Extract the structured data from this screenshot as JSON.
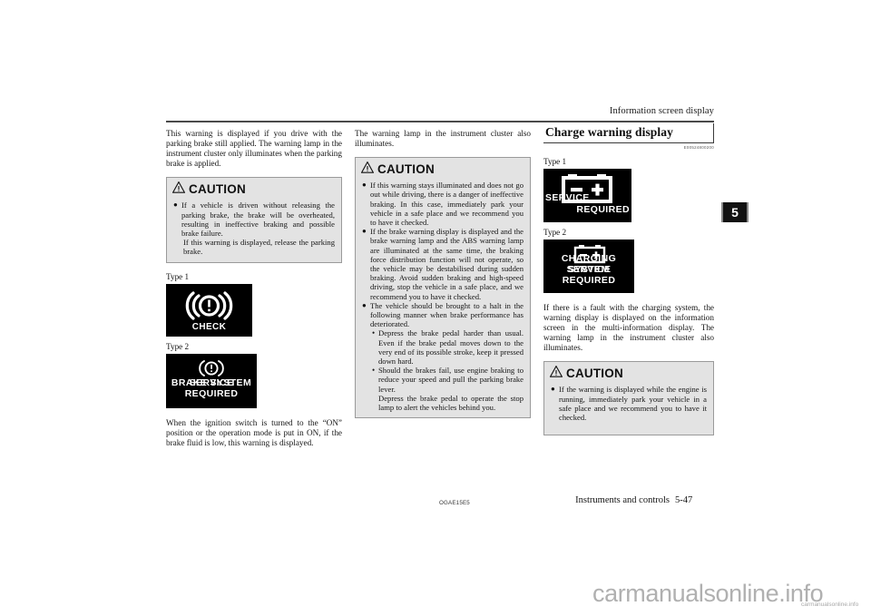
{
  "header": {
    "running_head": "Information screen display",
    "chapter_tab": "5"
  },
  "col1": {
    "intro": "This warning is displayed if you drive with the parking brake still applied. The warning lamp in the instrument cluster only illuminates when the parking brake is applied.",
    "caution": {
      "title": "CAUTION",
      "items": [
        "If a vehicle is driven without releasing the parking brake, the brake will be overheated, resulting in ineffective braking and possible brake failure.",
        "If this warning is displayed, release the parking brake."
      ]
    },
    "fig1_label": "Type 1",
    "fig1_text": "CHECK",
    "fig2_label": "Type 2",
    "fig2_line1": "BRAKE SYSTEM",
    "fig2_line2": "SERVICE REQUIRED",
    "outro": "When the ignition switch is turned to the “ON” position or the operation mode is put in ON, if the brake fluid is low, this warning is displayed."
  },
  "col2": {
    "intro": "The warning lamp in the instrument cluster also illuminates.",
    "caution": {
      "title": "CAUTION",
      "items": [
        "If this warning stays illuminated and does not go out while driving, there is a danger of ineffective braking. In this case, immediately park your vehicle in a safe place and we recommend you to have it checked.",
        "If the brake warning display is displayed and the brake warning lamp and the ABS warning lamp are illuminated at the same time, the braking force distribution function will not operate, so the vehicle may be destabilised during sudden braking. Avoid sudden braking and high-speed driving, stop the vehicle in a safe place, and we recommend you to have it checked.",
        "The vehicle should be brought to a halt in the following manner when brake performance has deteriorated."
      ],
      "subitems": [
        "Depress the brake pedal harder than usual. Even if the brake pedal moves down to the very end of its possible stroke, keep it pressed down hard.",
        "Should the brakes fail, use engine braking to reduce your speed and pull the parking brake lever."
      ],
      "trailing": "Depress the brake pedal to operate the stop lamp to alert the vehicles behind you."
    }
  },
  "col3": {
    "section_title": "Charge warning display",
    "section_code": "E00524800200",
    "fig1_label": "Type 1",
    "fig1_line1": "SERVICE",
    "fig1_line2": "REQUIRED",
    "fig2_label": "Type 2",
    "fig2_line1": "CHARGING SYSTEM",
    "fig2_line2": "SERVICE REQUIRED",
    "body": "If there is a fault with the charging system, the warning display is displayed on the information screen in the multi-information display. The warning lamp in the instrument cluster also illuminates.",
    "caution": {
      "title": "CAUTION",
      "items": [
        "If the warning is displayed while the engine is running, immediately park your vehicle in a safe place and we recommend you to have it checked."
      ]
    }
  },
  "footer": {
    "doc_code": "OGAE15E5",
    "section_name": "Instruments and controls",
    "page_number": "5-47"
  },
  "watermark": {
    "big": "carmanualsonline.info",
    "small": "carmanualsonline.info"
  }
}
